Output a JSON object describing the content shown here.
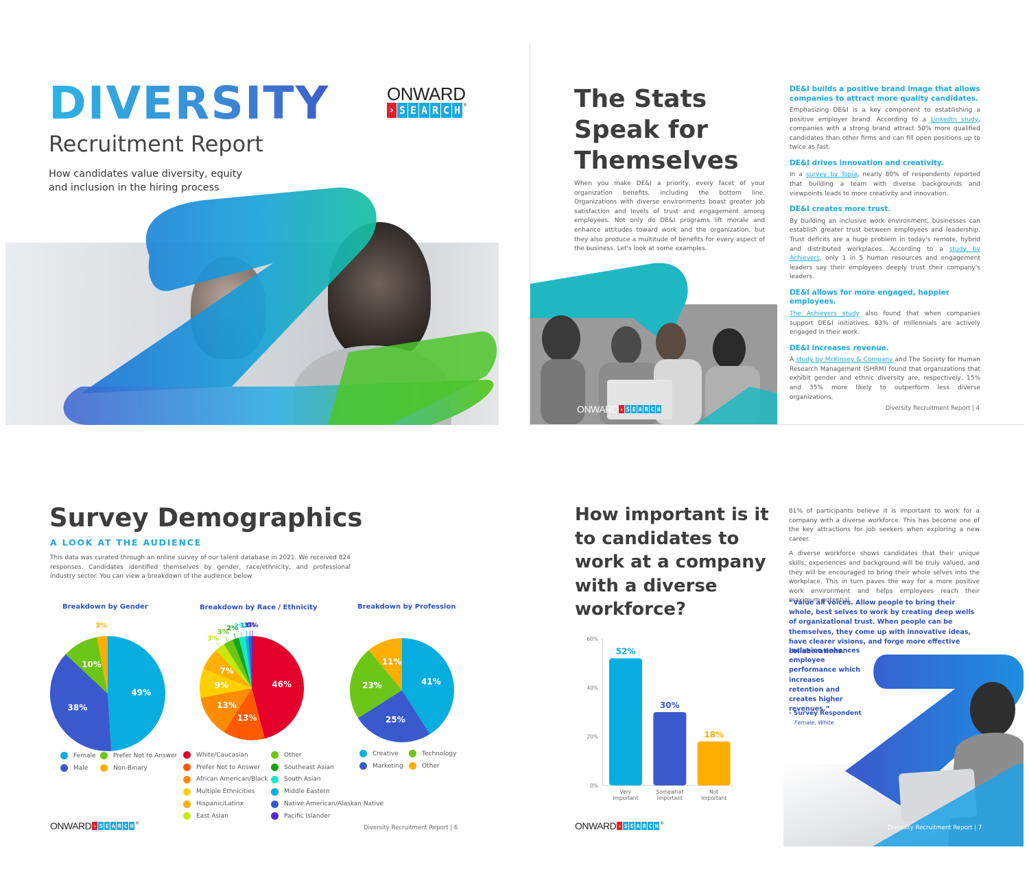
{
  "brand": {
    "onward": "ONWARD",
    "chevron": "›",
    "search_letters": [
      "S",
      "E",
      "A",
      "R",
      "C",
      "H"
    ],
    "registered": "®",
    "colors": {
      "red": "#e0202d",
      "blue": "#1ca9e0",
      "dark": "#222222"
    }
  },
  "page1": {
    "title": "DIVERSITY",
    "subtitle": "Recruitment Report",
    "tagline": "How candidates value diversity, equity and inclusion in the hiring process"
  },
  "page2": {
    "title": "The Stats Speak for Themselves",
    "intro": "When you make DE&I a priority, every facet of your organization benefits, including the bottom line. Organizations with diverse environments boast greater job satisfaction and levels of trust and engagement among employees. Not only do DE&I programs lift morale and enhance attitudes toward work and the organization, but they also produce a multitude of benefits for every aspect of the business. Let's look at some examples.",
    "sections": [
      {
        "heading": "DE&I builds a positive brand image that allows companies to attract more quality candidates.",
        "before": "Emphasizing DE&I is a key component to establishing a positive employer brand. According to a ",
        "link": "LinkedIn study",
        "after": ", companies with a strong brand attract 50% more qualified candidates than other firms and can fill open positions up to twice as fast."
      },
      {
        "heading": "DE&I drives innovation and creativity.",
        "before": "In a ",
        "link": "survey by Topia",
        "after": ", nearly 80% of respondents reported that building a team with diverse backgrounds and viewpoints leads to more creativity and innovation."
      },
      {
        "heading": "DE&I creates more trust.",
        "before": "By building an inclusive work environment, businesses can establish greater trust between employees and leadership. Trust deficits are a huge problem in today's remote, hybrid and distributed workplaces. According to a ",
        "link": "study by Achievers",
        "after": ", only 1 in 5 human resources and engagement leaders say their employees deeply trust their company's leaders."
      },
      {
        "heading": "DE&I allows for more engaged, happier employees.",
        "before": "",
        "link": "The Achievers study",
        "after": " also found that when companies support DE&I initiatives, 83% of millennials are actively engaged in their work."
      },
      {
        "heading": "DE&I increases revenue.",
        "before": "A ",
        "link": "study by McKinsey & Company",
        "after": " and The Society for Human Research Management (SHRM) found that organizations that exhibit gender and ethnic diversity are, respectively, 15% and 35% more likely to outperform less diverse organizations."
      }
    ],
    "footer": "Diversity Recruitment Report  | 4"
  },
  "page3": {
    "title": "Survey Demographics",
    "kicker": "A LOOK AT THE AUDIENCE",
    "description": "This data was curated through an online survey of our talent database in 2021. We received 824 responses. Candidates identified themselves by gender, race/ethnicity, and professional industry sector. You can view a breakdown of the audience below.",
    "footer": "Diversity Recruitment Report  | 6"
  },
  "page4": {
    "title": "How important is it to candidates to work at a company with a diverse workforce?",
    "paragraphs": [
      "81% of participants believe it is important to work for a company with a diverse workforce. This has become one of the key attractions for job seekers when exploring a new career.",
      "A diverse workforce shows candidates that their unique skills, experiences and background will be truly valued, and they will be encouraged to bring their whole selves into the workplace. This in turn paves the way for a more positive work environment and helps employees reach their maximum potential."
    ],
    "quote_main": "“Value all voices. Allow people to bring their whole, best selves to work by creating deep wells of organizational trust. When people can be themselves, they come up with innovative ideas, have clearer visions, and forge more effective collaborations.",
    "quote_tail": "Inclusion enhances employee performance which increases retention and creates higher revenues.”",
    "attribution": "- Survey Respondent",
    "attribution_detail": "Female, White",
    "footer": "Diversity Recruitment Report  | 7"
  },
  "chart_data": [
    {
      "type": "pie",
      "title": "Breakdown by Gender",
      "labels": [
        "Female",
        "Male",
        "Prefer Not to Answer",
        "Non-Binary"
      ],
      "values": [
        49,
        38,
        10,
        3
      ],
      "unit": "%",
      "colors": [
        "#08aee0",
        "#3a59cc",
        "#6cc617",
        "#fdae00"
      ],
      "legend": "bottom"
    },
    {
      "type": "pie",
      "title": "Breakdown by Race / Ethnicity",
      "labels": [
        "White/Caucasian",
        "Prefer Not to Answer",
        "African American/Black",
        "Multiple Ethnicities",
        "Hispanic/Latinx",
        "East Asian",
        "Other",
        "Southeast Asian",
        "South Asian",
        "Middle Eastern",
        "Native American/Alaskan Native",
        "Pacific Islander"
      ],
      "values": [
        46,
        13,
        13,
        9,
        7,
        3,
        3,
        2,
        2,
        1,
        1,
        0
      ],
      "unit": "%",
      "colors": [
        "#e4002b",
        "#ff5a00",
        "#ff8c00",
        "#ffd000",
        "#ffb000",
        "#c6e80d",
        "#6cc617",
        "#12a512",
        "#19e8c8",
        "#08aee0",
        "#3a59cc",
        "#5a2ad0"
      ],
      "legend": "bottom"
    },
    {
      "type": "pie",
      "title": "Breakdown by Profession",
      "labels": [
        "Creative",
        "Marketing",
        "Technology",
        "Other"
      ],
      "values": [
        41,
        25,
        23,
        11
      ],
      "unit": "%",
      "colors": [
        "#08aee0",
        "#3a59cc",
        "#6cc617",
        "#fdae00"
      ],
      "legend": "bottom"
    },
    {
      "type": "bar",
      "title": "",
      "categories": [
        "Very Important",
        "Somewhat Important",
        "Not Important"
      ],
      "values": [
        52,
        30,
        18
      ],
      "unit": "%",
      "colors": [
        "#08aee0",
        "#3a59cc",
        "#fdae00"
      ],
      "ylim": [
        0,
        60
      ],
      "yticks": [
        "0%",
        "20%",
        "40%",
        "60%"
      ],
      "ytick_values": [
        0,
        20,
        40,
        60
      ],
      "xlabel": "",
      "ylabel": "",
      "grid": false
    }
  ]
}
